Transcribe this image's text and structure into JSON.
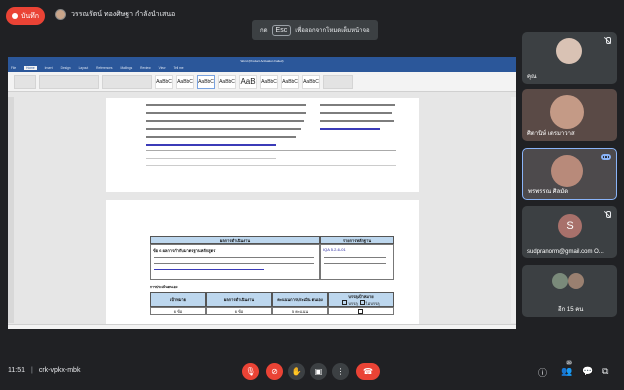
{
  "recording": {
    "label": "บันทึก"
  },
  "presenter": {
    "name": "วรรณรัตน์ ทองศิษฐา กำลังนำเสนอ"
  },
  "fullscreen_toast": {
    "prefix": "กด",
    "key": "Esc",
    "suffix": "เพื่อออกจากโหมดเต็มหน้าจอ"
  },
  "word_window": {
    "title": "Word (Product Activation Failed)",
    "tabs": [
      "File",
      "Home",
      "Insert",
      "Design",
      "Layout",
      "References",
      "Mailings",
      "Review",
      "View",
      "Tell me"
    ],
    "styles": [
      "AaBbC",
      "AaBbC",
      "AaBbC",
      "AaBbC",
      "AaB",
      "AaBbC",
      "AaBbC",
      "AaBbC"
    ],
    "page2_table": {
      "header_left": "ผลการดำเนินงาน",
      "header_right": "รายการหลักฐาน",
      "row_title": "ข้อ 6 ผลการกำกับมาตรฐานหลักสูตร",
      "evidence": "IQA 5.2-6-01",
      "assessment_title": "การประเมินตนเอง",
      "assess_headers": [
        "เป้าหมาย",
        "ผลการดำเนินงาน",
        "คะแนนการประเมิน ตนเอง",
        "บรรลุเป้าหมาย"
      ],
      "assess_values": [
        "6 ข้อ",
        "6 ข้อ",
        "5 คะแนน",
        ""
      ],
      "assess_checks": [
        "บรรลุ",
        "ไม่บรรลุ"
      ]
    }
  },
  "participants": [
    {
      "name": "คุณ",
      "mic_off": true
    },
    {
      "name": "ศิตานิษ์ เดรมาวาส",
      "mic_off": false
    },
    {
      "name": "พรพรรณ ศิลมัด",
      "mic_off": false,
      "speaking": true
    },
    {
      "name": "sudpranorm@gmail.com O...",
      "mic_off": true,
      "avatar_letter": "S"
    },
    {
      "name": "อีก 15 คน",
      "mic_off": false
    }
  ],
  "bottom_bar": {
    "time": "11:51",
    "meeting_code": "crk-vpkx-mbk",
    "participant_count": "20"
  },
  "colors": {
    "accent_red": "#ea4335",
    "word_blue": "#2b579a",
    "background": "#202124",
    "tile": "#3c4043"
  }
}
